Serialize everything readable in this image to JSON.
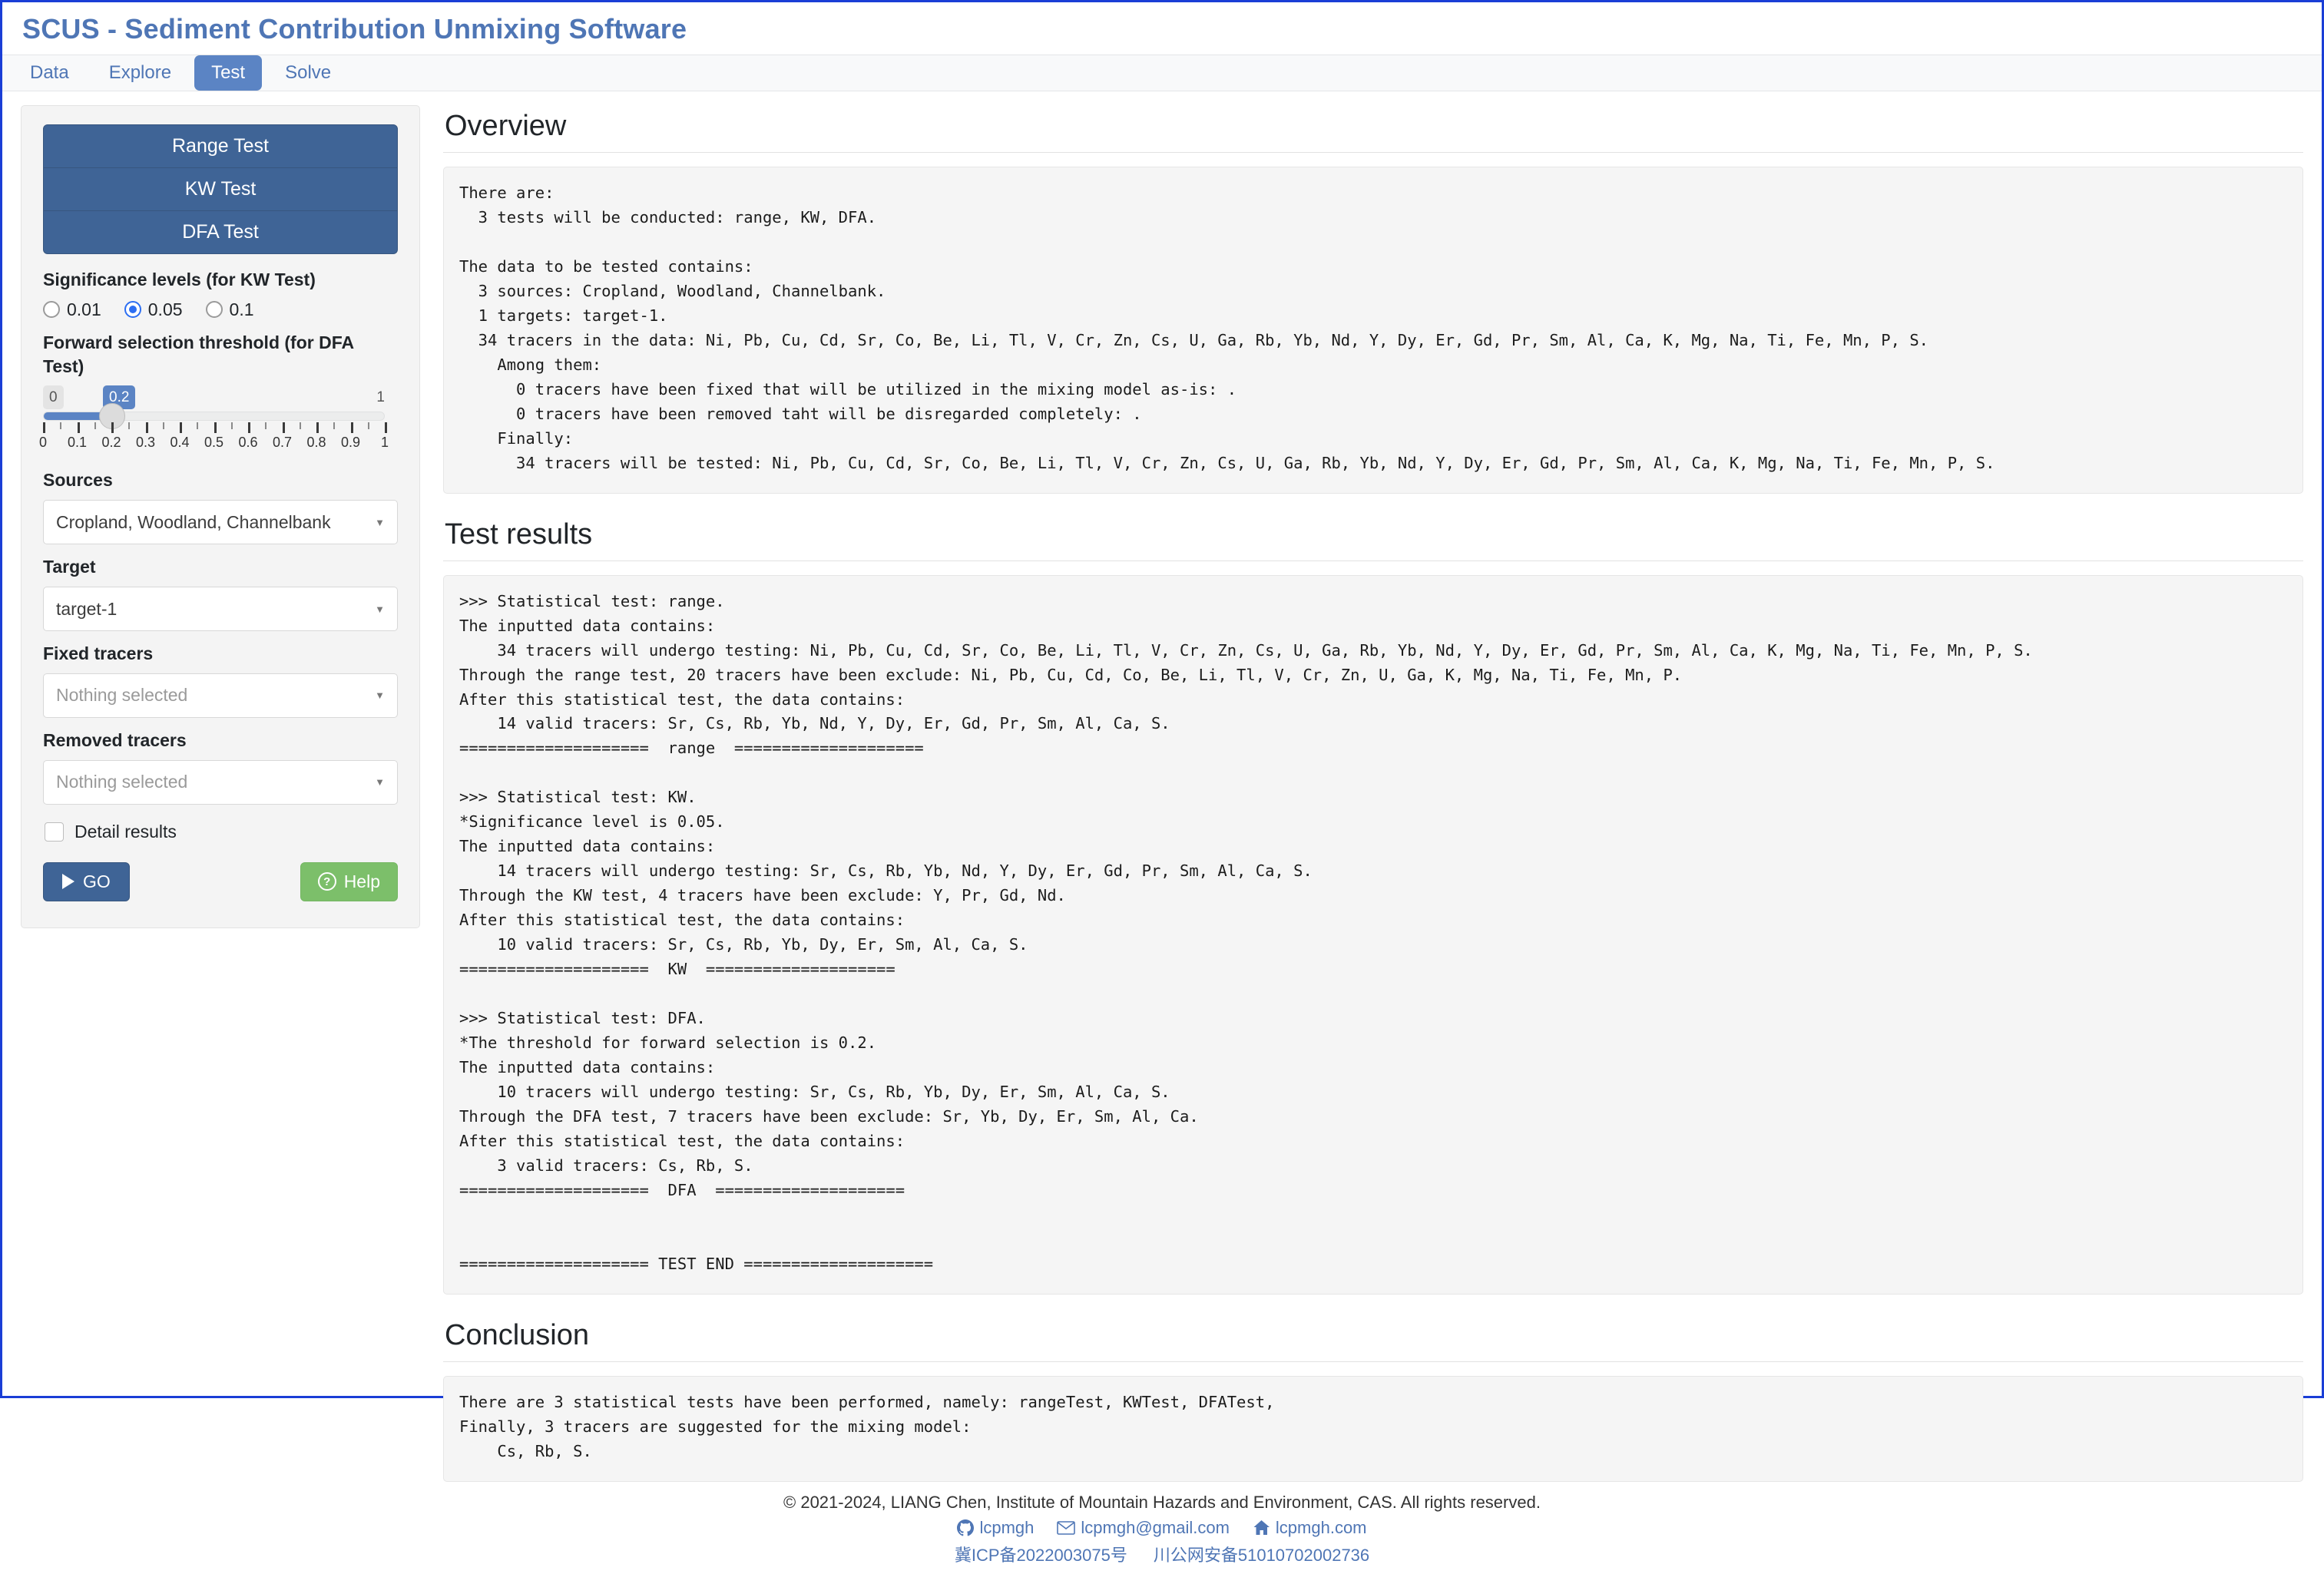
{
  "app": {
    "title": "SCUS - Sediment Contribution Unmixing Software"
  },
  "nav": {
    "tabs": [
      {
        "label": "Data",
        "active": false
      },
      {
        "label": "Explore",
        "active": false
      },
      {
        "label": "Test",
        "active": true
      },
      {
        "label": "Solve",
        "active": false
      }
    ]
  },
  "sidebar": {
    "test_buttons": [
      {
        "label": "Range Test"
      },
      {
        "label": "KW Test"
      },
      {
        "label": "DFA Test"
      }
    ],
    "significance": {
      "label": "Significance levels (for KW Test)",
      "options": [
        {
          "value": "0.01",
          "checked": false
        },
        {
          "value": "0.05",
          "checked": true
        },
        {
          "value": "0.1",
          "checked": false
        }
      ]
    },
    "threshold": {
      "label": "Forward selection threshold (for DFA Test)",
      "min_bubble": "0",
      "max_bubble": "1",
      "value_bubble": "0.2",
      "value": 0.2,
      "tick_labels": [
        "0",
        "0.1",
        "0.2",
        "0.3",
        "0.4",
        "0.5",
        "0.6",
        "0.7",
        "0.8",
        "0.9",
        "1"
      ]
    },
    "sources": {
      "label": "Sources",
      "value": "Cropland, Woodland, Channelbank"
    },
    "target": {
      "label": "Target",
      "value": "target-1"
    },
    "fixed_tracers": {
      "label": "Fixed tracers",
      "value": "Nothing selected"
    },
    "removed_tracers": {
      "label": "Removed tracers",
      "value": "Nothing selected"
    },
    "detail_results": {
      "label": "Detail results",
      "checked": false
    },
    "go_button": {
      "label": "GO"
    },
    "help_button": {
      "label": "Help"
    }
  },
  "main": {
    "overview": {
      "title": "Overview",
      "text": "There are:\n  3 tests will be conducted: range, KW, DFA.\n\nThe data to be tested contains:\n  3 sources: Cropland, Woodland, Channelbank.\n  1 targets: target-1.\n  34 tracers in the data: Ni, Pb, Cu, Cd, Sr, Co, Be, Li, Tl, V, Cr, Zn, Cs, U, Ga, Rb, Yb, Nd, Y, Dy, Er, Gd, Pr, Sm, Al, Ca, K, Mg, Na, Ti, Fe, Mn, P, S.\n    Among them:\n      0 tracers have been fixed that will be utilized in the mixing model as-is: .\n      0 tracers have been removed taht will be disregarded completely: .\n    Finally:\n      34 tracers will be tested: Ni, Pb, Cu, Cd, Sr, Co, Be, Li, Tl, V, Cr, Zn, Cs, U, Ga, Rb, Yb, Nd, Y, Dy, Er, Gd, Pr, Sm, Al, Ca, K, Mg, Na, Ti, Fe, Mn, P, S."
    },
    "test_results": {
      "title": "Test results",
      "text": ">>> Statistical test: range.\nThe inputted data contains:\n    34 tracers will undergo testing: Ni, Pb, Cu, Cd, Sr, Co, Be, Li, Tl, V, Cr, Zn, Cs, U, Ga, Rb, Yb, Nd, Y, Dy, Er, Gd, Pr, Sm, Al, Ca, K, Mg, Na, Ti, Fe, Mn, P, S.\nThrough the range test, 20 tracers have been exclude: Ni, Pb, Cu, Cd, Co, Be, Li, Tl, V, Cr, Zn, U, Ga, K, Mg, Na, Ti, Fe, Mn, P.\nAfter this statistical test, the data contains:\n    14 valid tracers: Sr, Cs, Rb, Yb, Nd, Y, Dy, Er, Gd, Pr, Sm, Al, Ca, S.\n====================  range  ====================\n\n>>> Statistical test: KW.\n*Significance level is 0.05.\nThe inputted data contains:\n    14 tracers will undergo testing: Sr, Cs, Rb, Yb, Nd, Y, Dy, Er, Gd, Pr, Sm, Al, Ca, S.\nThrough the KW test, 4 tracers have been exclude: Y, Pr, Gd, Nd.\nAfter this statistical test, the data contains:\n    10 valid tracers: Sr, Cs, Rb, Yb, Dy, Er, Sm, Al, Ca, S.\n====================  KW  ====================\n\n>>> Statistical test: DFA.\n*The threshold for forward selection is 0.2.\nThe inputted data contains:\n    10 tracers will undergo testing: Sr, Cs, Rb, Yb, Dy, Er, Sm, Al, Ca, S.\nThrough the DFA test, 7 tracers have been exclude: Sr, Yb, Dy, Er, Sm, Al, Ca.\nAfter this statistical test, the data contains:\n    3 valid tracers: Cs, Rb, S.\n====================  DFA  ====================\n\n\n==================== TEST END ===================="
    },
    "conclusion": {
      "title": "Conclusion",
      "text": "There are 3 statistical tests have been performed, namely: rangeTest, KWTest, DFATest,\nFinally, 3 tracers are suggested for the mixing model:\n    Cs, Rb, S."
    }
  },
  "footer": {
    "copyright": "© 2021-2024, LIANG Chen, Institute of Mountain Hazards and Environment, CAS. All rights reserved.",
    "links": [
      {
        "icon": "github-icon",
        "label": "lcpmgh"
      },
      {
        "icon": "email-icon",
        "label": "lcpmgh@gmail.com"
      },
      {
        "icon": "home-icon",
        "label": "lcpmgh.com"
      }
    ],
    "icp": "冀ICP备2022003075号",
    "police": "川公网安备51010702002736"
  },
  "colors": {
    "brand": "#4f76b5",
    "tab_active": "#5b84c4",
    "test_button": "#3f6496",
    "help_green": "#7cbf6a",
    "panel_bg": "#f5f5f5"
  }
}
